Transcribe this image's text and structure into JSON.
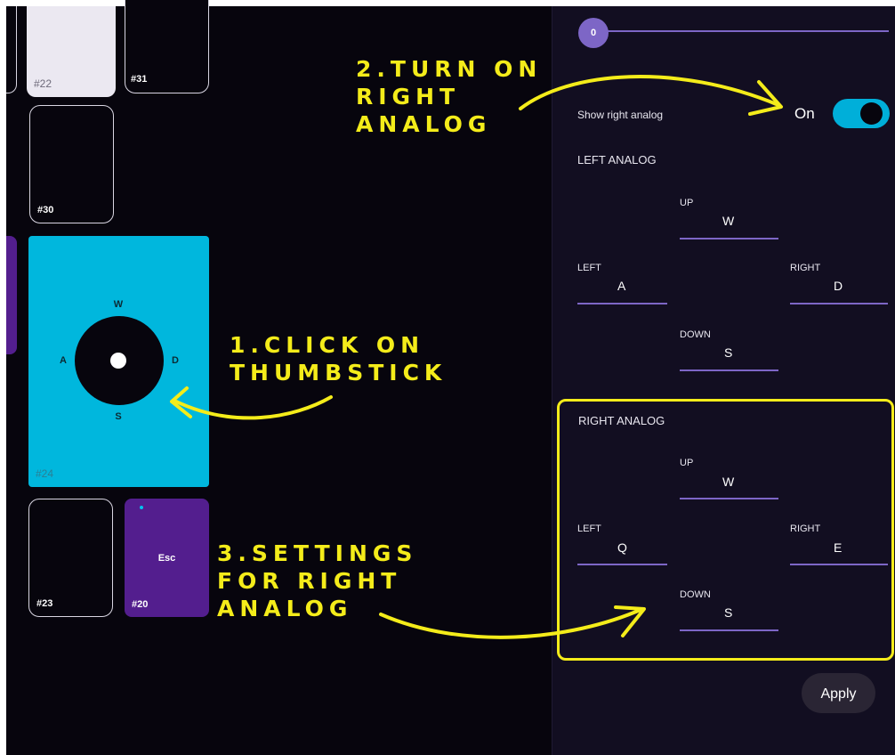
{
  "tiles": {
    "t22": "#22",
    "t31": "#31",
    "t30": "#30",
    "t24": "#24",
    "t23": "#23",
    "t20": "#20",
    "t20_key": "Esc"
  },
  "thumbstick": {
    "up": "W",
    "left": "A",
    "right": "D",
    "down": "S"
  },
  "slider": {
    "value": "0"
  },
  "settings": {
    "show_right_analog_label": "Show right analog",
    "toggle_state": "On",
    "left_analog": {
      "title": "LEFT ANALOG",
      "up_label": "UP",
      "up_value": "W",
      "left_label": "LEFT",
      "left_value": "A",
      "right_label": "RIGHT",
      "right_value": "D",
      "down_label": "DOWN",
      "down_value": "S"
    },
    "right_analog": {
      "title": "RIGHT ANALOG",
      "up_label": "UP",
      "up_value": "W",
      "left_label": "LEFT",
      "left_value": "Q",
      "right_label": "RIGHT",
      "right_value": "E",
      "down_label": "DOWN",
      "down_value": "S"
    },
    "apply_label": "Apply"
  },
  "annotations": {
    "step1_line1": "1.CLICK ON",
    "step1_line2": "THUMBSTICK",
    "step2_line1": "2.TURN ON",
    "step2_line2": "RIGHT",
    "step2_line3": "ANALOG",
    "step3_line1": "3.SETTINGS",
    "step3_line2": "FOR RIGHT",
    "step3_line3": "ANALOG"
  },
  "colors": {
    "background": "#07050d",
    "panel": "#120e21",
    "accent_cyan": "#00b7dd",
    "accent_purple": "#7d66c6",
    "key_purple": "#531e8e",
    "annotation_yellow": "#f4ec1a"
  }
}
